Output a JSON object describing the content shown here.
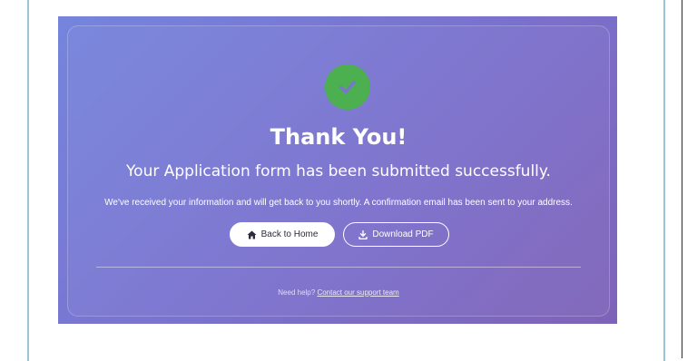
{
  "card": {
    "icon": "check-circle-icon",
    "title": "Thank You!",
    "subtitle": "Your Application form has been submitted successfully.",
    "message": "We've received your information and will get back to you shortly. A confirmation email has been sent to your address.",
    "buttons": {
      "home": {
        "label": "Back to Home",
        "icon": "home-icon"
      },
      "pdf": {
        "label": "Download PDF",
        "icon": "download-icon"
      }
    },
    "help": {
      "prefix": "Need help?",
      "link": "Contact our support team"
    }
  },
  "colors": {
    "gradient_start": "#7585dc",
    "gradient_end": "#7e63b8",
    "success": "#4caf50",
    "text": "#ffffff",
    "frame_border": "#9cc3d8"
  }
}
